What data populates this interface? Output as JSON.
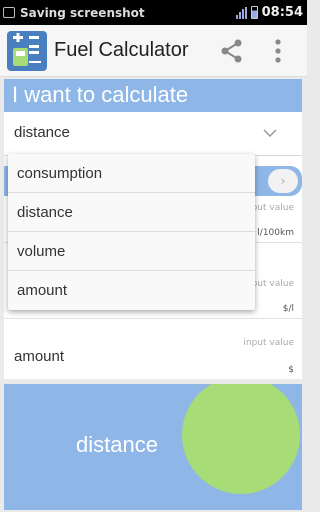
{
  "status_bar": {
    "notification": "Saving screenshot",
    "time": "08:54"
  },
  "app_bar": {
    "title": "Fuel Calculator",
    "share_icon": "share-icon",
    "more_icon": "more-vert-icon"
  },
  "calc": {
    "banner": "I want to calculate",
    "selected": "distance"
  },
  "fields": {
    "consumption": {
      "label": "consumption",
      "placeholder": "input value",
      "unit": "l/100km"
    },
    "volume": {
      "label": "volume",
      "placeholder": "input value",
      "unit": "$/l"
    },
    "amount": {
      "label": "amount",
      "placeholder": "input value",
      "unit": "$"
    }
  },
  "dropdown": {
    "options": [
      "consumption",
      "distance",
      "volume",
      "amount"
    ]
  },
  "result": {
    "label": "distance"
  },
  "colors": {
    "accent_blue": "#8eb6e6",
    "result_circle": "#a8dc77",
    "status_bar": "#000000"
  }
}
